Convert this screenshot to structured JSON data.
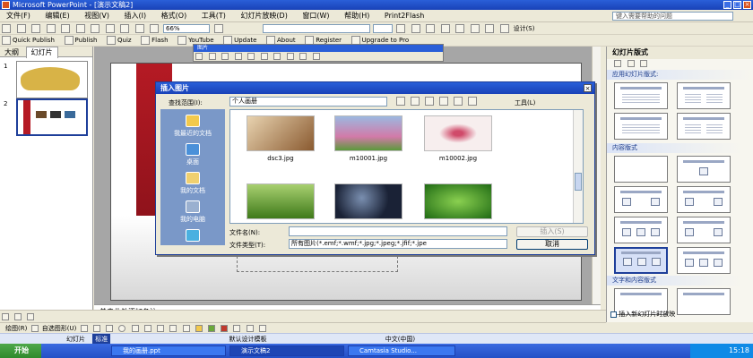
{
  "window": {
    "title": "Microsoft PowerPoint - [演示文稿2]",
    "minimize": "_",
    "restore": "□",
    "close": "×"
  },
  "menubar": {
    "items": [
      "文件(F)",
      "编辑(E)",
      "视图(V)",
      "插入(I)",
      "格式(O)",
      "工具(T)",
      "幻灯片放映(D)",
      "窗口(W)",
      "帮助(H)",
      "Print2Flash"
    ],
    "help_placeholder": "键入需要帮助的问题"
  },
  "standard_toolbar": {
    "zoom": "66%",
    "design_label": "设计(S)"
  },
  "plugin_toolbar": {
    "items": [
      "Quick Publish",
      "Publish",
      "Quiz",
      "Flash",
      "YouTube",
      "Update",
      "About",
      "Register",
      "Upgrade to Pro"
    ]
  },
  "left_panel": {
    "tabs": [
      "大纲",
      "幻灯片"
    ],
    "slide_numbers": [
      "1",
      "2"
    ]
  },
  "picture_toolbar": {
    "title": "图片"
  },
  "dialog": {
    "title": "插入图片",
    "lookin_label": "查找范围(I):",
    "lookin_value": "个人画册",
    "tools_label": "工具(L)",
    "places": [
      "我最近的文档",
      "桌面",
      "我的文档",
      "我的电脑",
      ""
    ],
    "files": [
      {
        "name": "dsc3.jpg",
        "color": "#c99a6a"
      },
      {
        "name": "m10001.jpg",
        "color": "#d27aa8"
      },
      {
        "name": "m10002.jpg",
        "color": "#f0e8e8"
      },
      {
        "name": "",
        "color": "#6aa83a"
      },
      {
        "name": "",
        "color": "#23304a"
      },
      {
        "name": "",
        "color": "#3f9a2a"
      }
    ],
    "filename_label": "文件名(N):",
    "filetype_label": "文件类型(T):",
    "filetype_value": "所有图片(*.emf;*.wmf;*.jpg;*.jpeg;*.jfif;*.jpe",
    "insert_button": "插入(S)",
    "cancel_button": "取消"
  },
  "notes": {
    "placeholder": "单击此处添加备注"
  },
  "task_pane": {
    "title": "幻灯片版式",
    "section_apply": "应用幻灯片版式:",
    "section_content": "内容版式",
    "section_text_content": "文字和内容版式",
    "show_on_insert": "插入新幻灯片时放映"
  },
  "draw_toolbar": {
    "draw_label": "绘图(R)",
    "autoshapes_label": "自选图形(U)"
  },
  "status_bar": {
    "slide_label": "幻灯片",
    "design": "默认设计模板",
    "language": "中文(中国)"
  },
  "language_bar": {
    "ime": "标准"
  },
  "taskbar": {
    "start": "开始",
    "tasks": [
      "我的画册.ppt",
      "演示文稿2",
      "Camtasia Studio..."
    ],
    "time": "15:18"
  }
}
